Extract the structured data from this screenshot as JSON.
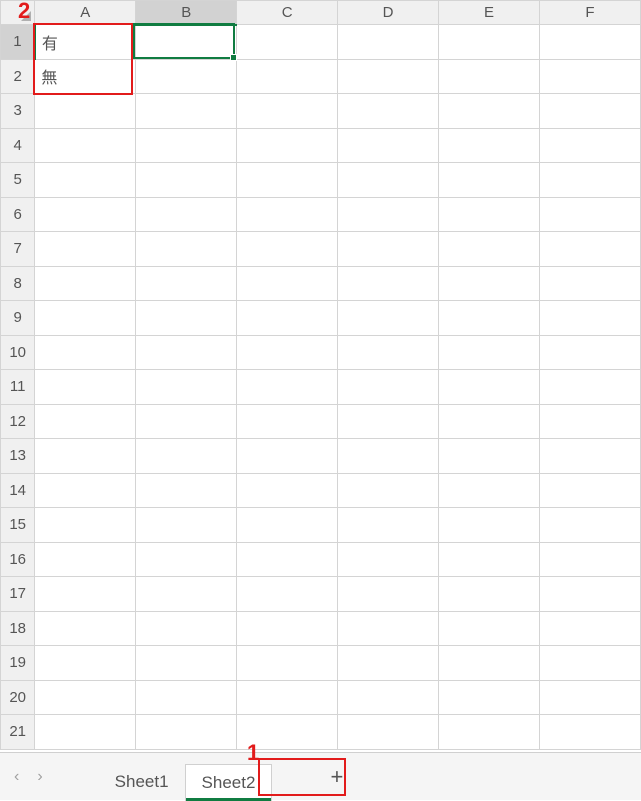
{
  "columns": [
    "A",
    "B",
    "C",
    "D",
    "E",
    "F"
  ],
  "rows": [
    "1",
    "2",
    "3",
    "4",
    "5",
    "6",
    "7",
    "8",
    "9",
    "10",
    "11",
    "12",
    "13",
    "14",
    "15",
    "16",
    "17",
    "18",
    "19",
    "20",
    "21"
  ],
  "cells": {
    "A1": "有",
    "A2": "無"
  },
  "active_cell": "B1",
  "tabs": {
    "items": [
      "Sheet1",
      "Sheet2"
    ],
    "active": "Sheet2"
  },
  "nav": {
    "prev": "‹",
    "next": "›",
    "add": "+"
  },
  "callouts": {
    "one": "1",
    "two": "2"
  }
}
